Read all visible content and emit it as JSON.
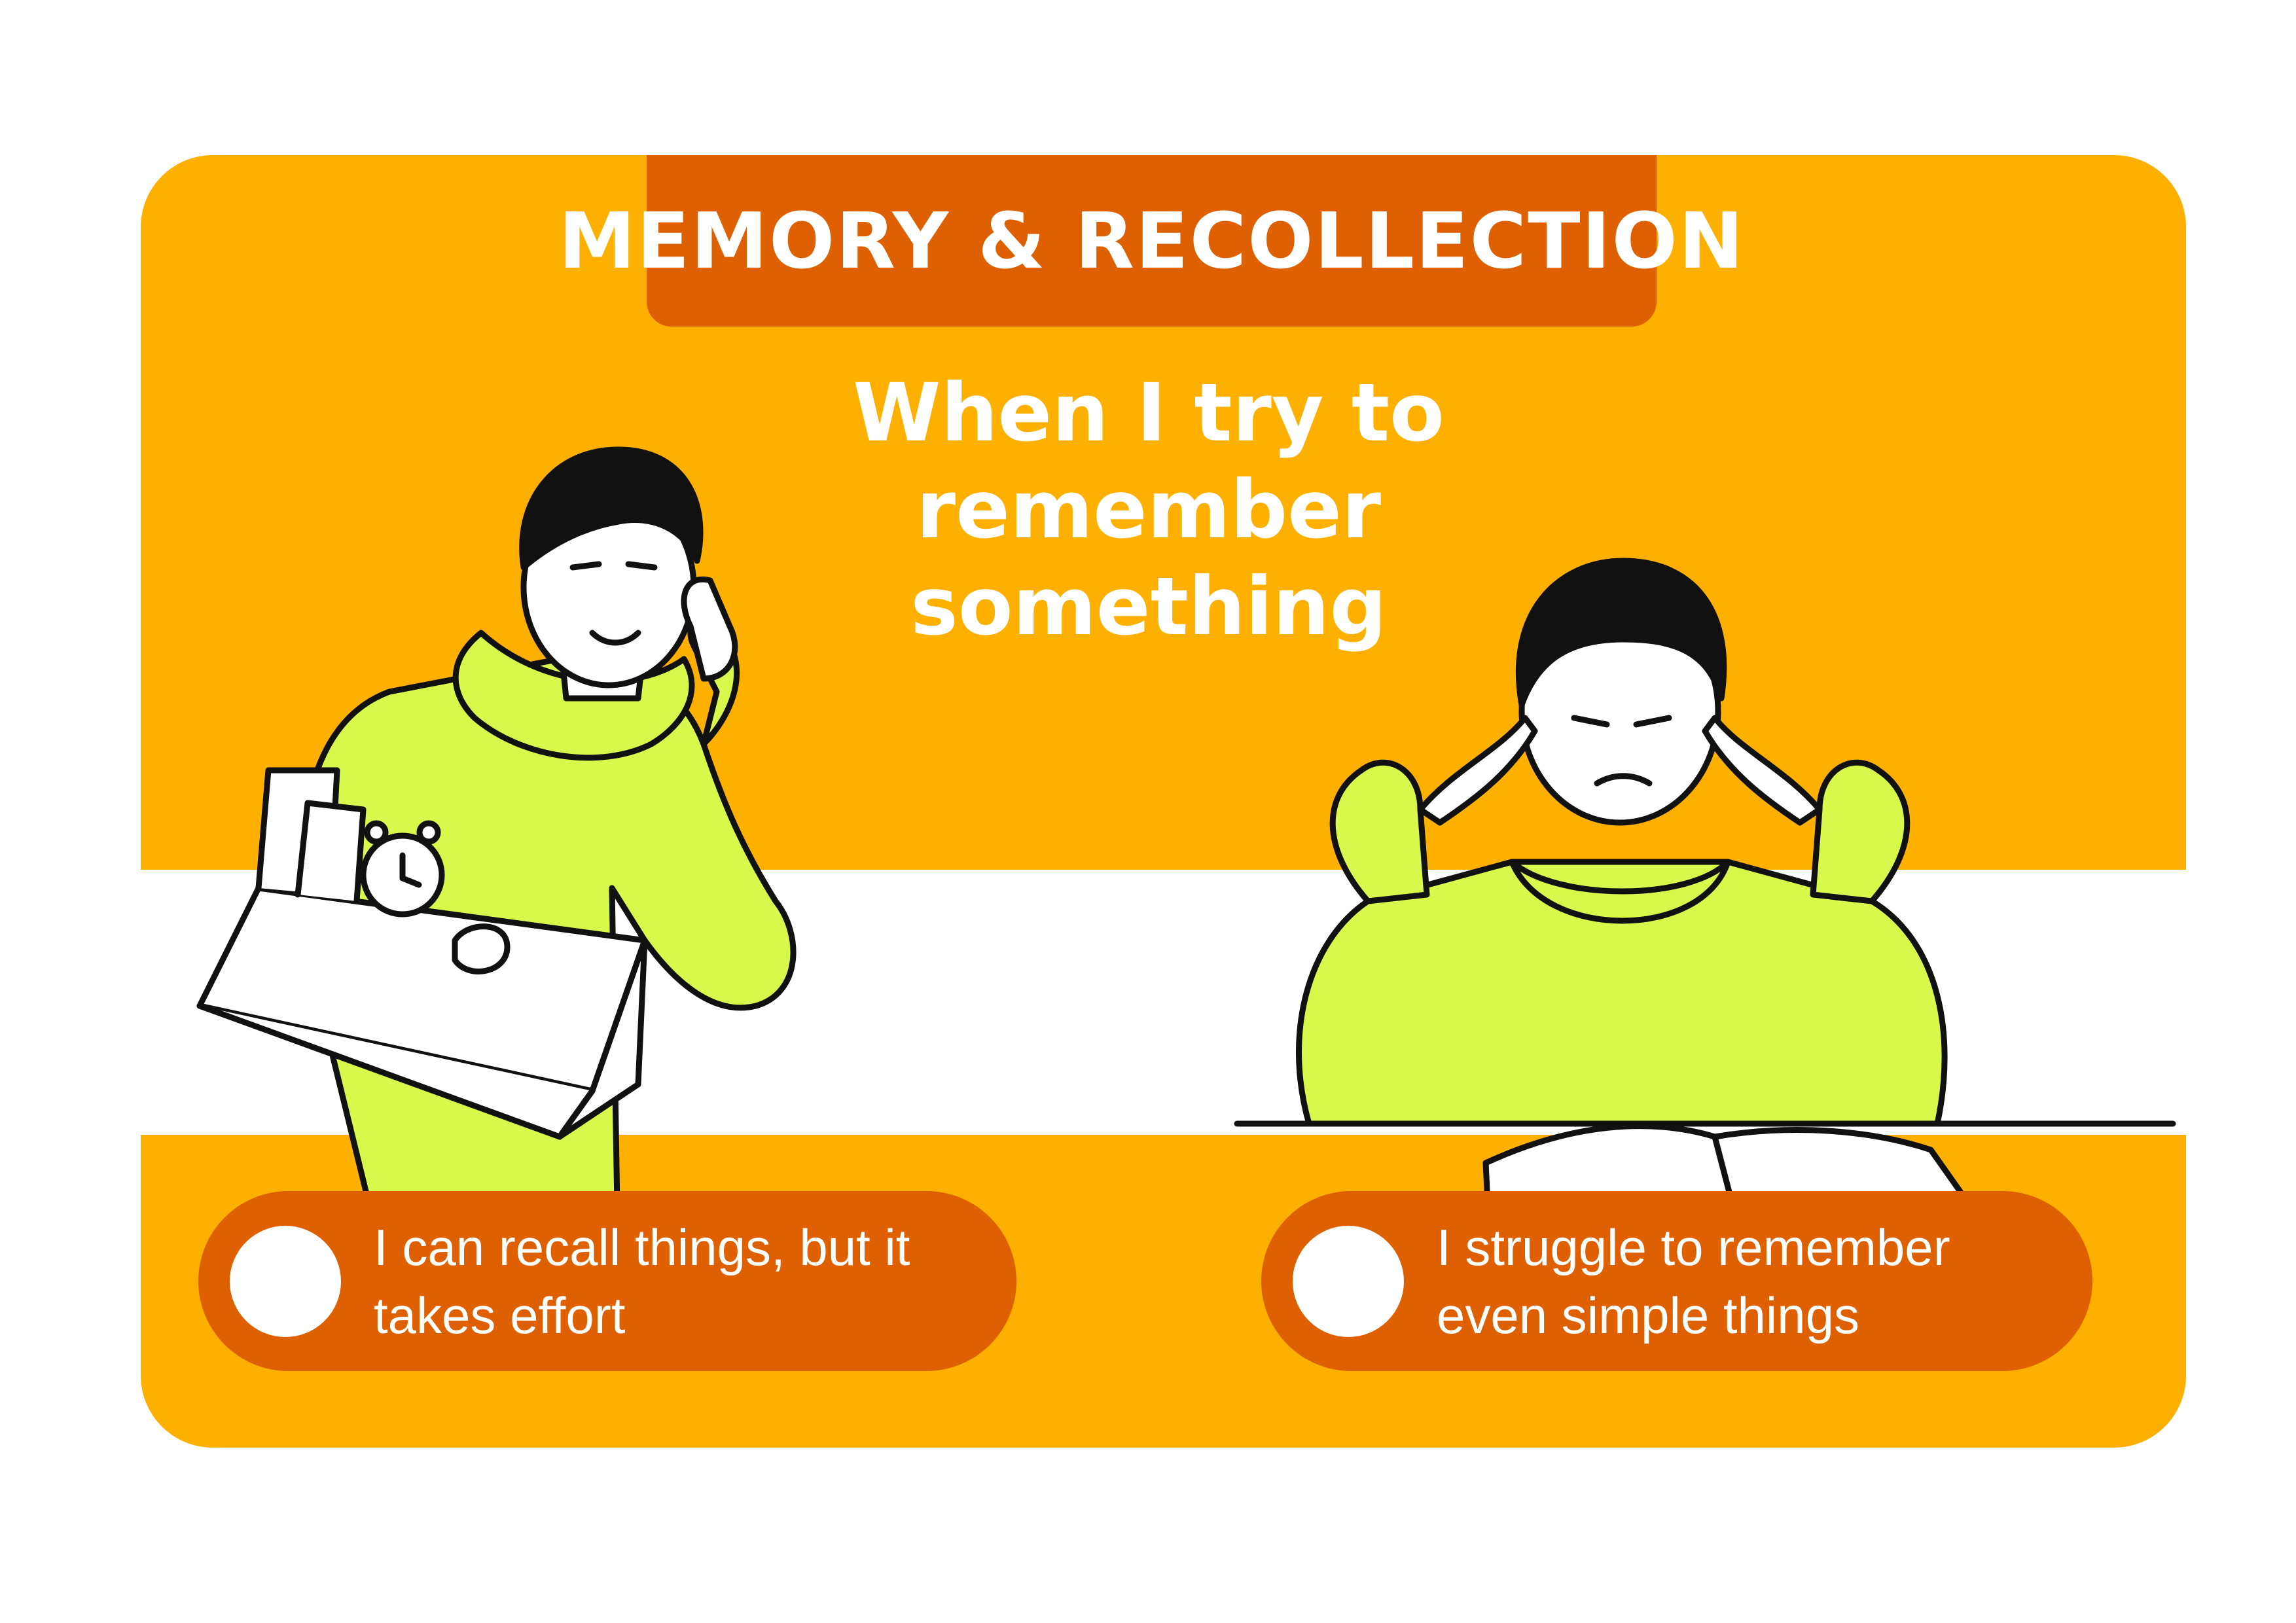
{
  "header": {
    "title": "MEMORY & RECOLLECTION"
  },
  "question": {
    "line1": "When I try to remember",
    "line2": "something"
  },
  "colors": {
    "card": "#FDB000",
    "accent": "#DE6000",
    "shirt": "#D8F84C",
    "text": "#FFFFFF"
  },
  "illustrations": {
    "left": "man-holding-box-pointing-to-temple-icon",
    "right": "man-frustrated-at-desk-with-book-icon"
  },
  "options": [
    {
      "line1": "I can recall things, but it",
      "line2": "takes effort"
    },
    {
      "line1": "I struggle to remember",
      "line2": "even simple things"
    }
  ]
}
